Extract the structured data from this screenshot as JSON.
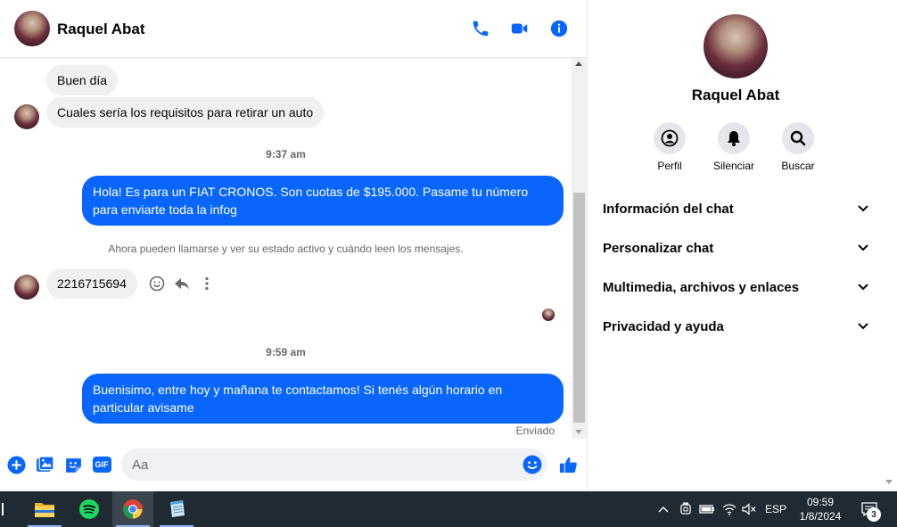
{
  "chat": {
    "contact_name": "Raquel Abat",
    "messages": {
      "in_1": "Buen día",
      "in_2": "Cuales sería los requisitos para retirar un auto",
      "time_1": "9:37 am",
      "out_1": "Hola! Es para un FIAT CRONOS. Son cuotas de $195.000. Pasame tu número para enviarte toda la infog",
      "system_note": "Ahora pueden llamarse y ver su estado activo y cuándo leen los mensajes.",
      "in_3": "2216715694",
      "time_2": "9:59 am",
      "out_2": "Buenisimo, entre hoy y mañana te contactamos! Si tenés algún horario en particular avisame",
      "status": "Enviado"
    },
    "composer": {
      "placeholder": "Aa",
      "gif_label": "GIF"
    }
  },
  "info_panel": {
    "name": "Raquel Abat",
    "actions": {
      "profile": "Perfil",
      "mute": "Silenciar",
      "search": "Buscar"
    },
    "sections": {
      "chat_info": "Información del chat",
      "customize": "Personalizar chat",
      "media": "Multimedia, archivos y enlaces",
      "privacy": "Privacidad y ayuda"
    }
  },
  "taskbar": {
    "lang": "ESP",
    "time": "09:59",
    "date": "1/8/2024",
    "notifications": "3"
  },
  "colors": {
    "accent": "#0866ff",
    "bubble_in": "#f0f0f0",
    "taskbar": "#1f2a33"
  }
}
